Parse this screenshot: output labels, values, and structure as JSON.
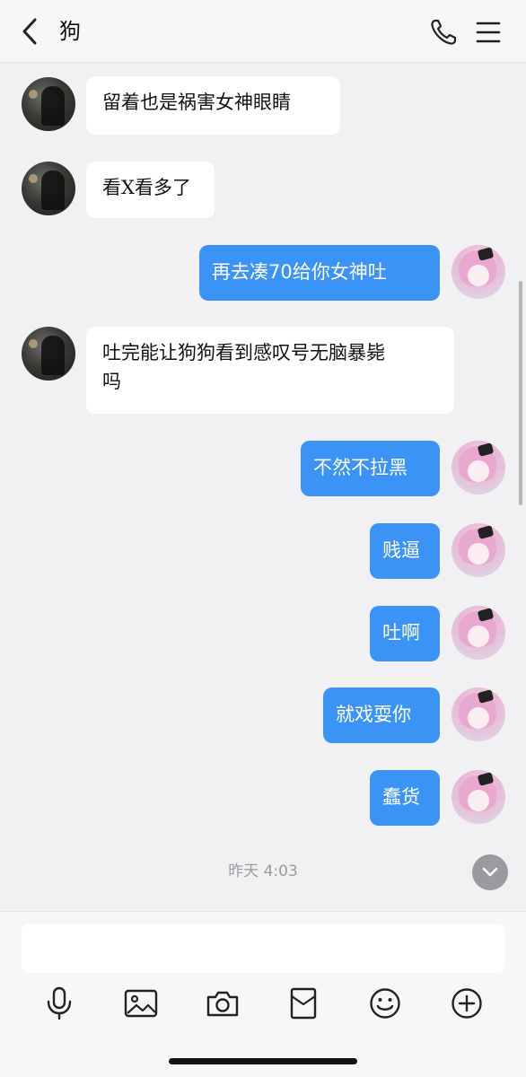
{
  "header": {
    "back_icon": "chevron-left-icon",
    "title": "狗",
    "call_icon": "phone-icon",
    "menu_icon": "hamburger-menu-icon"
  },
  "messages": [
    {
      "side": "left",
      "text": "留着也是祸害女神眼睛"
    },
    {
      "side": "left",
      "text": "看X看多了"
    },
    {
      "side": "right",
      "text": "再去凑70给你女神吐"
    },
    {
      "side": "left",
      "text": "吐完能让狗狗看到感叹号无脑暴毙\n吗"
    },
    {
      "side": "right",
      "text": "不然不拉黑"
    },
    {
      "side": "right",
      "text": "贱逼"
    },
    {
      "side": "right",
      "text": "吐啊"
    },
    {
      "side": "right",
      "text": "就戏耍你"
    },
    {
      "side": "right",
      "text": "蠢货"
    }
  ],
  "timestamp": "昨天 4:03",
  "input": {
    "value": "",
    "placeholder": ""
  },
  "toolbar": {
    "icons": [
      "microphone-icon",
      "image-icon",
      "camera-icon",
      "red-packet-icon",
      "emoji-icon",
      "plus-icon"
    ]
  },
  "colors": {
    "bubble_right": "#3c93f6",
    "bubble_left": "#ffffff",
    "background": "#f1f1f3"
  }
}
